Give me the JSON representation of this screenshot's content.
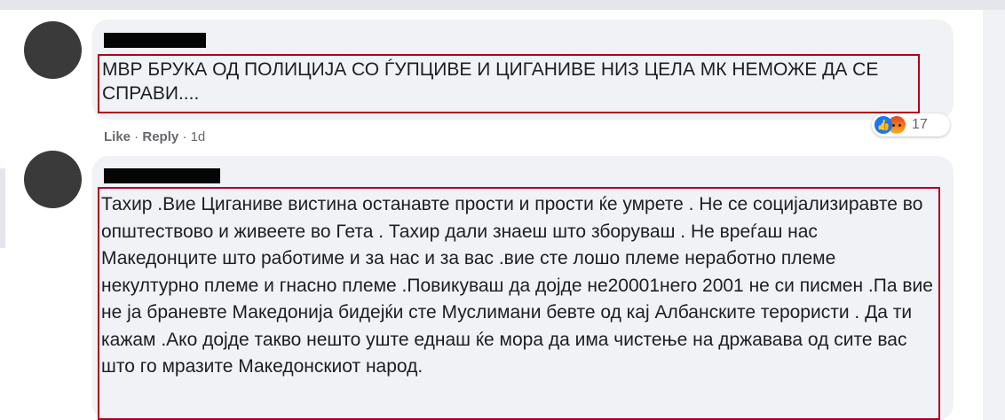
{
  "comments": [
    {
      "text": "МВР БРУКА ОД ПОЛИЦИЈА СО ЃУПЦИВЕ И ЦИГАНИВЕ НИЗ ЦЕЛА МК НЕМОЖЕ ДА СЕ СПРАВИ....",
      "actions": {
        "like": "Like",
        "reply": "Reply",
        "time": "1d"
      },
      "reactions": {
        "icons": [
          "like-icon",
          "angry-icon"
        ],
        "count": "17"
      }
    },
    {
      "text": "Тахир .Вие Циганиве вистина останавте прости и прости ќе умрете . Не се социјализиравте во општествово и живеете во Гета . Тахир дали знаеш што зборуваш . Не вреѓаш нас Македонците што работиме и за нас и за вас .вие сте лошо племе неработно племе некултурно племе и гнасно племе .Повикуваш да дојде не20001него 2001 не си писмен .Па вие не ја браневте Македонија бидејќи сте Муслимани бевте од кај Албанските терористи . Да ти кажам .Ако дојде такво нешто уште еднаш ќе мора да има чистење на државава од сите вас што го мразите Македонскиот народ."
    }
  ],
  "colors": {
    "highlight": "#b00020",
    "bubble": "#f0f2f5",
    "link": "#65676b",
    "like": "#1877f2"
  }
}
